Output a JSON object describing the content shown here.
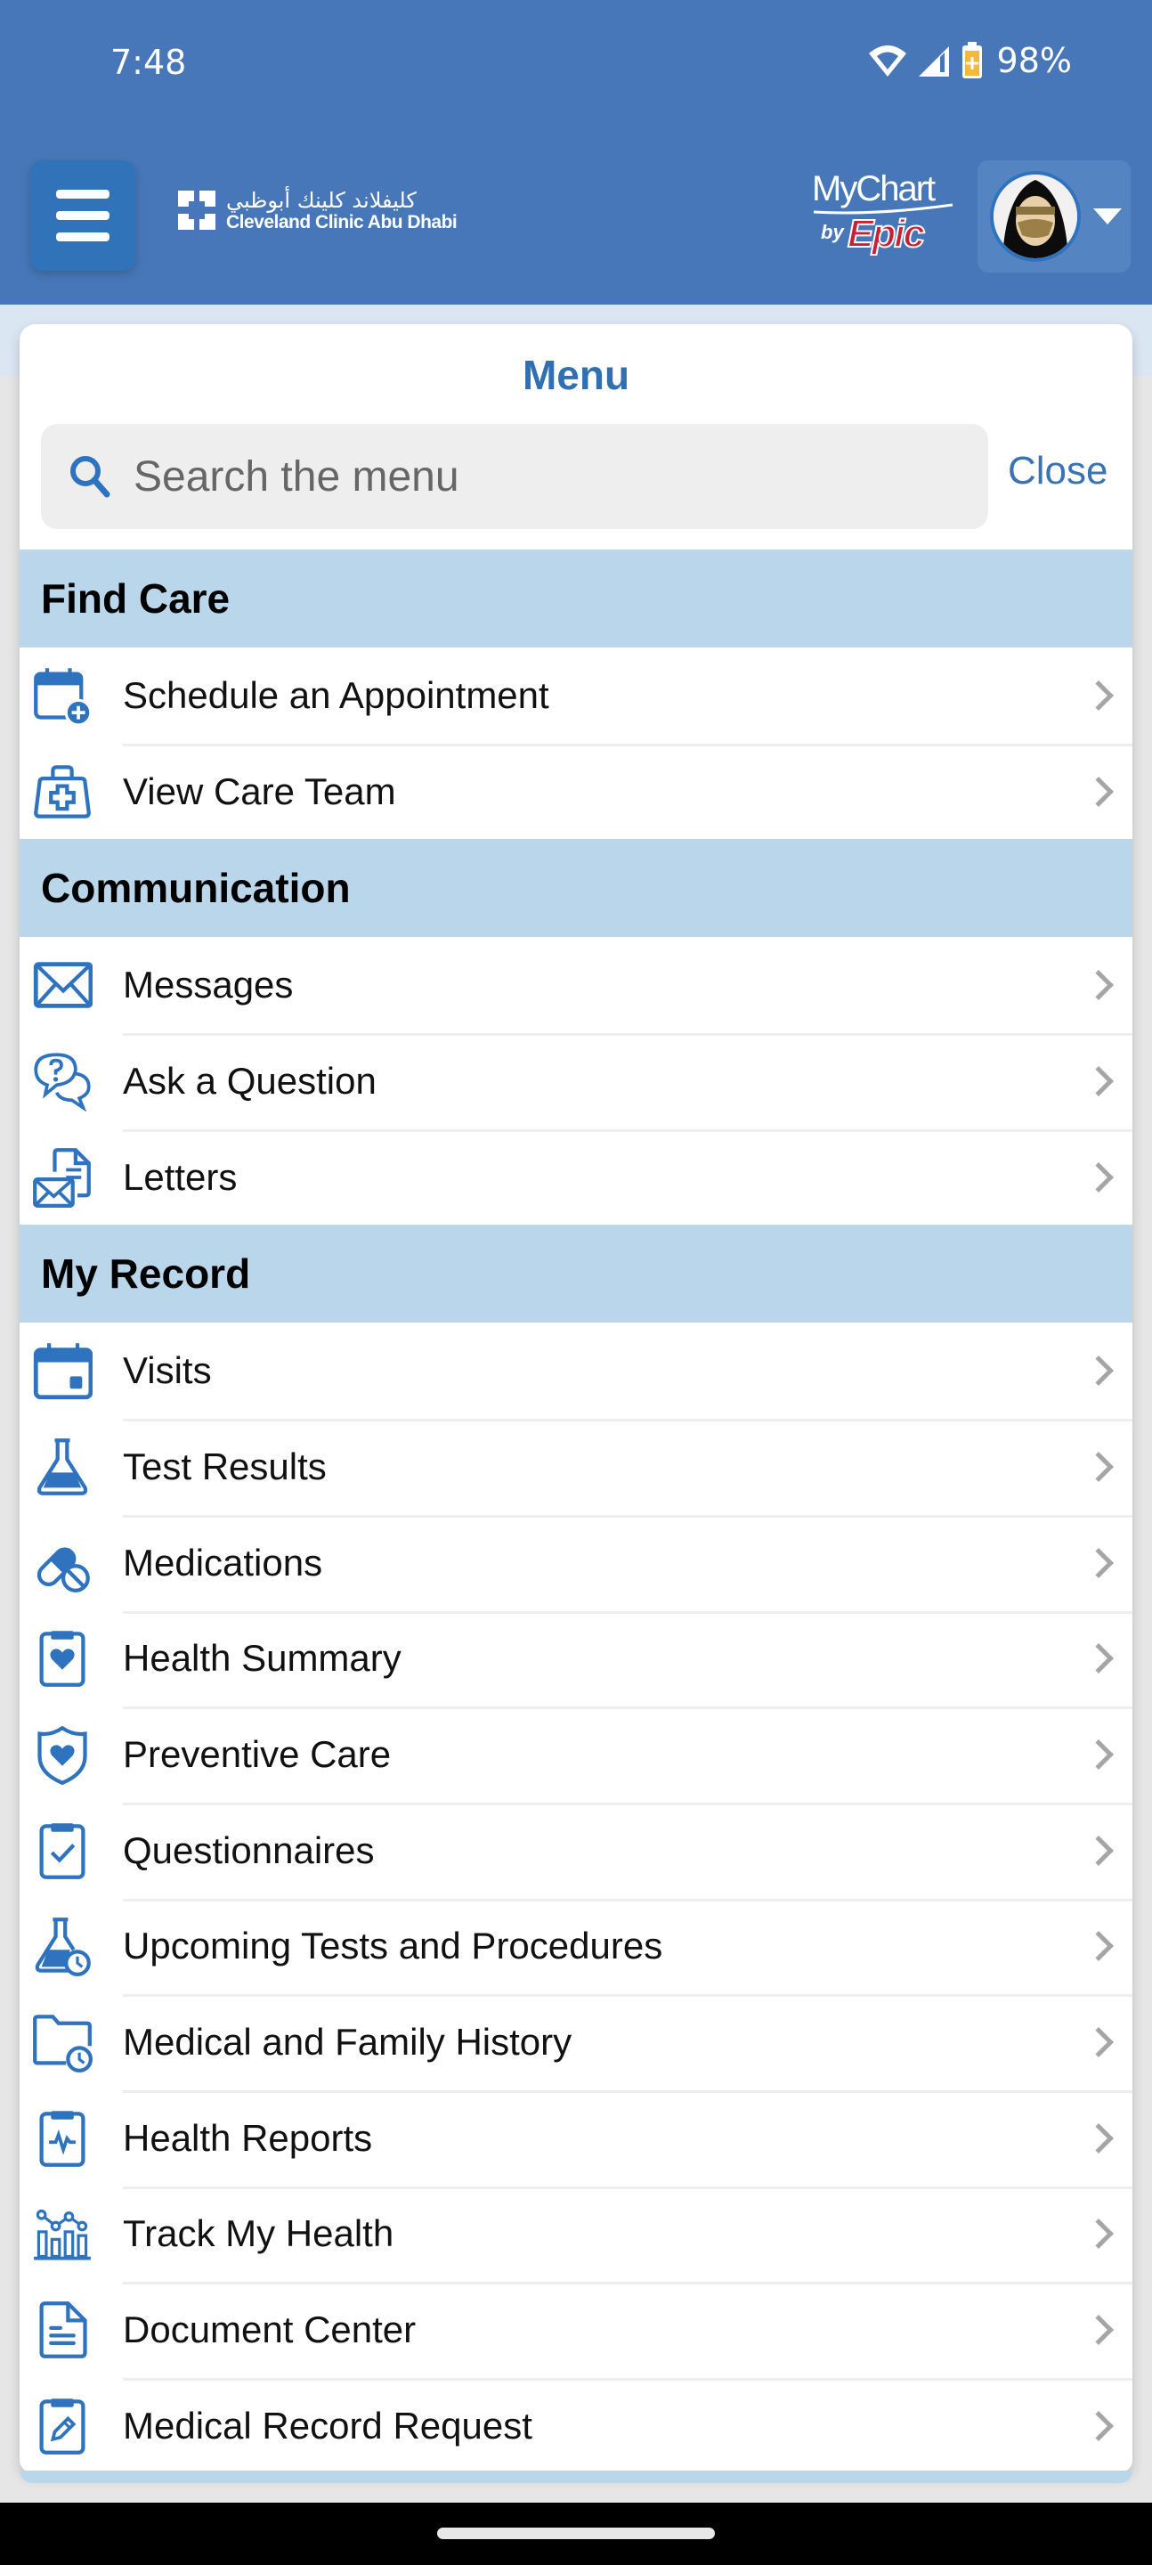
{
  "status_bar": {
    "time": "7:48",
    "battery_percent": "98%",
    "icons": [
      "wifi-icon",
      "cell-signal-icon",
      "battery-charging-icon"
    ]
  },
  "app_bar": {
    "menu_button_icon": "hamburger-icon",
    "org_logo": {
      "arabic_name": "كليفلاند كلينك أبوظبي",
      "english_name": "Cleveland Clinic Abu Dhabi"
    },
    "product_logo": {
      "name": "MyChart",
      "by": "by",
      "vendor": "Epic"
    },
    "account_menu_icon": "caret-down-icon"
  },
  "menu": {
    "title": "Menu",
    "search_placeholder": "Search the menu",
    "search_value": "",
    "close_label": "Close",
    "sections": [
      {
        "title": "Find Care",
        "items": [
          {
            "label": "Schedule an Appointment",
            "icon": "calendar-plus-icon"
          },
          {
            "label": "View Care Team",
            "icon": "medical-bag-icon"
          }
        ]
      },
      {
        "title": "Communication",
        "items": [
          {
            "label": "Messages",
            "icon": "envelope-icon"
          },
          {
            "label": "Ask a Question",
            "icon": "question-chat-icon"
          },
          {
            "label": "Letters",
            "icon": "letter-document-icon"
          }
        ]
      },
      {
        "title": "My Record",
        "items": [
          {
            "label": "Visits",
            "icon": "calendar-icon"
          },
          {
            "label": "Test Results",
            "icon": "flask-icon"
          },
          {
            "label": "Medications",
            "icon": "pills-icon"
          },
          {
            "label": "Health Summary",
            "icon": "clipboard-heart-icon"
          },
          {
            "label": "Preventive Care",
            "icon": "shield-heart-icon"
          },
          {
            "label": "Questionnaires",
            "icon": "clipboard-check-icon"
          },
          {
            "label": "Upcoming Tests and Procedures",
            "icon": "flask-clock-icon"
          },
          {
            "label": "Medical and Family History",
            "icon": "folder-clock-icon"
          },
          {
            "label": "Health Reports",
            "icon": "clipboard-pulse-icon"
          },
          {
            "label": "Track My Health",
            "icon": "bar-line-chart-icon"
          },
          {
            "label": "Document Center",
            "icon": "document-icon"
          },
          {
            "label": "Medical Record Request",
            "icon": "clipboard-pencil-icon"
          }
        ]
      }
    ]
  },
  "colors": {
    "app_bar": "#4777b8",
    "accent": "#2f6fb2",
    "section_header": "#bad6ea",
    "icon": "#2f73bf",
    "epic_red": "#c8203a"
  }
}
